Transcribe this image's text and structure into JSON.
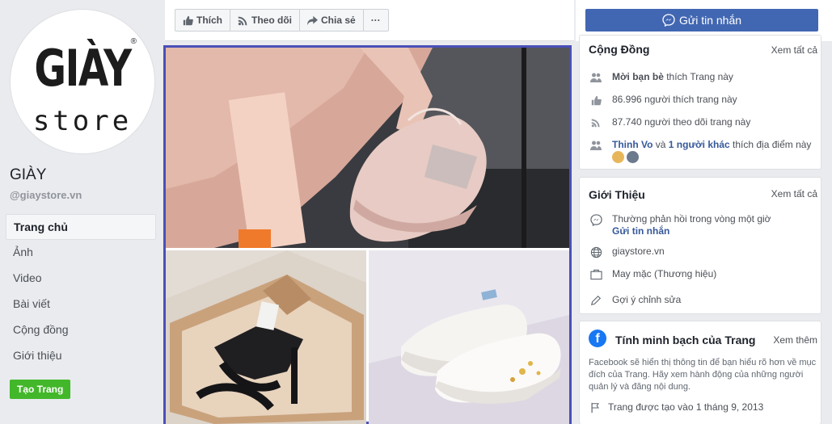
{
  "page": {
    "logo_top": "GIÀY",
    "logo_bottom": "store",
    "logo_reg": "®",
    "name": "GIÀY",
    "handle": "@giaystore.vn"
  },
  "nav": {
    "items": [
      "Trang chủ",
      "Ảnh",
      "Video",
      "Bài viết",
      "Cộng đồng",
      "Giới thiệu"
    ],
    "active": "Trang chủ"
  },
  "create_page_label": "Tạo Trang",
  "actions": {
    "like": "Thích",
    "follow": "Theo dõi",
    "share": "Chia sẻ",
    "more": "···"
  },
  "message_button": "Gửi tin nhắn",
  "community": {
    "title": "Cộng Đồng",
    "see_all": "Xem tất cả",
    "new_friends_bold": "Mời bạn bè",
    "new_friends_rest": " thích Trang này",
    "likes": "86.996 người thích trang này",
    "followers": "87.740 người theo dõi trang này",
    "checkin_name1": "Thinh Vo",
    "checkin_and": " và ",
    "checkin_name2": "1 người khác",
    "checkin_rest": " thích địa điểm này"
  },
  "about": {
    "title": "Giới Thiệu",
    "see_all": "Xem tất cả",
    "response": "Thường phản hồi trong vòng một giờ",
    "send_message": "Gửi tin nhắn",
    "website": "giaystore.vn",
    "category": "May mặc (Thương hiệu)",
    "suggest_edit": "Gợi ý chỉnh sửa"
  },
  "transparency": {
    "title": "Tính minh bạch của Trang",
    "see_more": "Xem thêm",
    "description": "Facebook sẽ hiển thị thông tin để bạn hiểu rõ hơn về mục đích của Trang. Hãy xem hành động của những người quản lý và đăng nội dung.",
    "created": "Trang được tạo vào 1 tháng 9, 2013"
  },
  "colors": {
    "brand_blue": "#4267b2",
    "link_blue": "#365899",
    "create_green": "#42b72a",
    "photo_border": "#4a50b8"
  },
  "icons": {
    "like": "thumb-up-icon",
    "follow": "rss-icon",
    "share": "share-arrow-icon",
    "messenger": "messenger-icon"
  }
}
